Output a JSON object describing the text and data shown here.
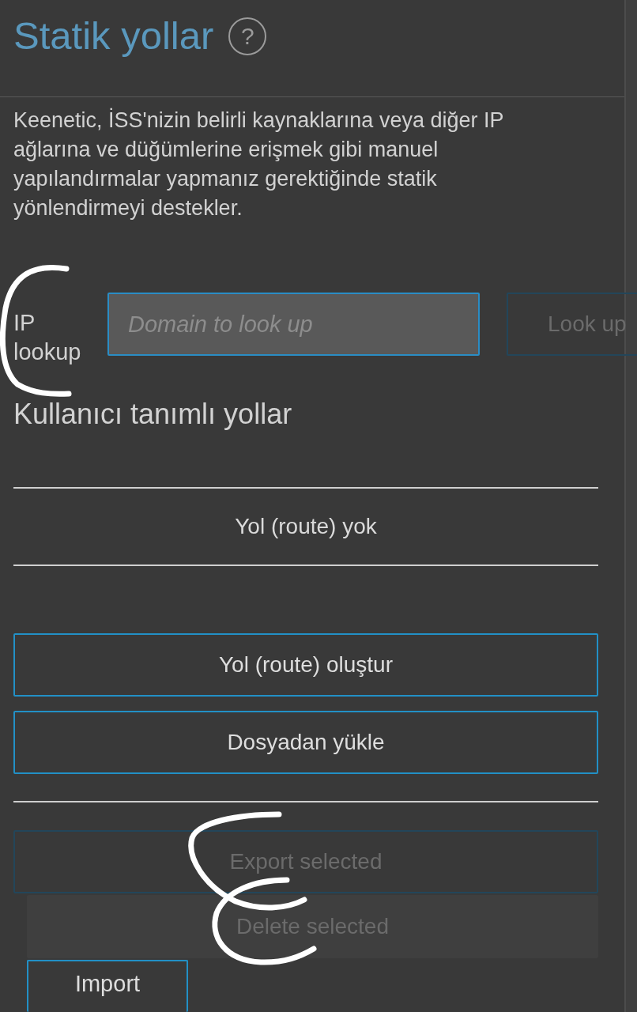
{
  "header": {
    "title": "Statik yollar",
    "help": "?"
  },
  "description": "Keenetic, İSS'nizin belirli kaynaklarına veya diğer IP ağlarına ve düğümlerine erişmek gibi manuel yapılandırmalar yapmanız gerektiğinde statik yönlendirmeyi destekler.",
  "ip_lookup": {
    "label": "IP lookup",
    "placeholder": "Domain to look up",
    "button": {
      "label": "Look up",
      "disabled": true
    }
  },
  "user_routes": {
    "title": "Kullanıcı tanımlı yollar",
    "empty_message": "Yol (route) yok"
  },
  "actions": [
    {
      "label": "Yol (route) oluştur",
      "disabled": false
    },
    {
      "label": "Dosyadan yükle",
      "disabled": false
    }
  ],
  "bulk_actions": [
    {
      "label": "Export selected",
      "kind": "outlined",
      "disabled": true
    },
    {
      "label": "Delete selected",
      "kind": "filled",
      "disabled": true
    }
  ],
  "import_button": {
    "label": "Import",
    "disabled": false
  }
}
